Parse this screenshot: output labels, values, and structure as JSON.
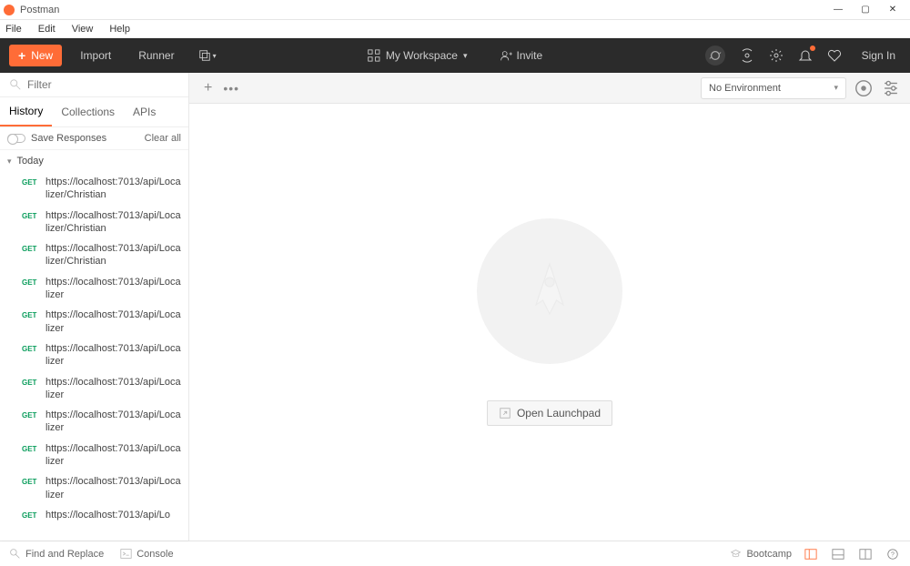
{
  "app_title": "Postman",
  "menubar": [
    "File",
    "Edit",
    "View",
    "Help"
  ],
  "toolbar": {
    "new_label": "New",
    "import_label": "Import",
    "runner_label": "Runner",
    "workspace_label": "My Workspace",
    "invite_label": "Invite",
    "sign_in_label": "Sign In"
  },
  "sidebar": {
    "filter_placeholder": "Filter",
    "tabs": [
      "History",
      "Collections",
      "APIs"
    ],
    "active_tab_index": 0,
    "save_responses_label": "Save Responses",
    "clear_all_label": "Clear all",
    "group_label": "Today",
    "history": [
      {
        "method": "GET",
        "url": "https://localhost:7013/api/Localizer/Christian"
      },
      {
        "method": "GET",
        "url": "https://localhost:7013/api/Localizer/Christian"
      },
      {
        "method": "GET",
        "url": "https://localhost:7013/api/Localizer/Christian"
      },
      {
        "method": "GET",
        "url": "https://localhost:7013/api/Localizer"
      },
      {
        "method": "GET",
        "url": "https://localhost:7013/api/Localizer"
      },
      {
        "method": "GET",
        "url": "https://localhost:7013/api/Localizer"
      },
      {
        "method": "GET",
        "url": "https://localhost:7013/api/Localizer"
      },
      {
        "method": "GET",
        "url": "https://localhost:7013/api/Localizer"
      },
      {
        "method": "GET",
        "url": "https://localhost:7013/api/Localizer"
      },
      {
        "method": "GET",
        "url": "https://localhost:7013/api/Localizer"
      },
      {
        "method": "GET",
        "url": "https://localhost:7013/api/Lo"
      }
    ]
  },
  "main": {
    "environment_label": "No Environment",
    "open_launchpad_label": "Open Launchpad"
  },
  "statusbar": {
    "find_replace": "Find and Replace",
    "console": "Console",
    "bootcamp": "Bootcamp"
  }
}
